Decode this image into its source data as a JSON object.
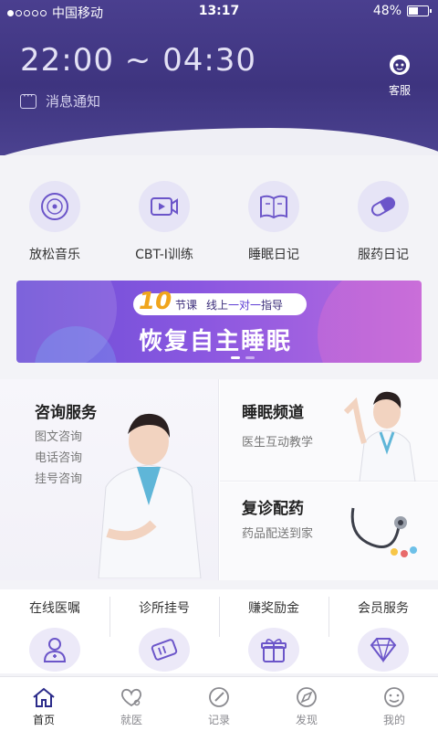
{
  "status_bar": {
    "carrier": "中国移动",
    "time": "13:17",
    "battery": "48%",
    "battery_level": 0.48
  },
  "header": {
    "sleep_time": "22:00 ~ 04:30",
    "notice": "消息通知",
    "customer_service": "客服"
  },
  "quick_actions": [
    {
      "label": "放松音乐",
      "icon": "music-disc-icon"
    },
    {
      "label": "CBT-I训练",
      "icon": "video-icon"
    },
    {
      "label": "睡眠日记",
      "icon": "book-icon"
    },
    {
      "label": "服药日记",
      "icon": "pill-icon"
    }
  ],
  "banner": {
    "number": "10",
    "course": "节课",
    "online": "线上",
    "one_on_one": "一对一",
    "guide": "指导",
    "title": "恢复自主睡眠"
  },
  "services": {
    "consult": {
      "title": "咨询服务",
      "items": [
        "图文咨询",
        "电话咨询",
        "挂号咨询"
      ]
    },
    "sleep_channel": {
      "title": "睡眠频道",
      "subtitle": "医生互动教学"
    },
    "revisit": {
      "title": "复诊配药",
      "subtitle": "药品配送到家"
    }
  },
  "more_services": [
    {
      "label": "在线医嘱",
      "icon": "doctor-icon"
    },
    {
      "label": "诊所挂号",
      "icon": "ticket-icon"
    },
    {
      "label": "赚奖励金",
      "icon": "gift-icon"
    },
    {
      "label": "会员服务",
      "icon": "diamond-icon"
    }
  ],
  "tabs": [
    {
      "label": "首页",
      "icon": "home-icon",
      "active": true
    },
    {
      "label": "就医",
      "icon": "heart-stethoscope-icon",
      "active": false
    },
    {
      "label": "记录",
      "icon": "record-icon",
      "active": false
    },
    {
      "label": "发现",
      "icon": "compass-icon",
      "active": false
    },
    {
      "label": "我的",
      "icon": "smile-icon",
      "active": false
    }
  ],
  "colors": {
    "header": "#3e347f",
    "accent": "#6b4ed6",
    "banner_gold": "#f0a51c"
  }
}
